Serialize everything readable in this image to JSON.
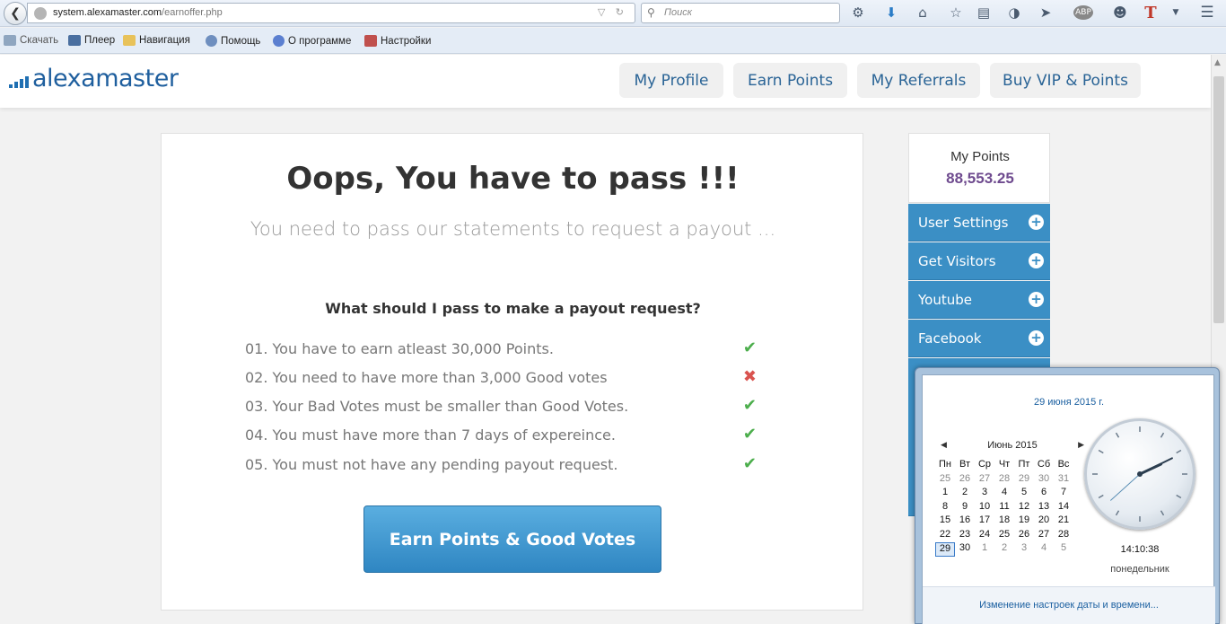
{
  "browser": {
    "url_host": "system.alexamaster.com",
    "url_path": "/earnoffer.php",
    "search_placeholder": "Поиск",
    "bookmarks": [
      {
        "label": "Скачать",
        "icon": "download-bookmark-icon"
      },
      {
        "label": "Плеер",
        "icon": "player-icon"
      },
      {
        "label": "Навигация",
        "icon": "folder-icon"
      },
      {
        "label": "Помощь",
        "icon": "help-icon"
      },
      {
        "label": "О программе",
        "icon": "info-icon"
      },
      {
        "label": "Настройки",
        "icon": "tools-icon"
      }
    ],
    "toolbar_icons": [
      "extension-icon",
      "download-arrow-icon",
      "home-icon",
      "star-icon",
      "reading-list-icon",
      "pocket-icon",
      "send-icon",
      "adblock-icon",
      "chat-icon",
      "translate-icon",
      "menu-icon"
    ],
    "adblock_label": "ABP",
    "translate_label": "T"
  },
  "site": {
    "logo": "alexamaster",
    "nav": [
      {
        "label": "My Profile"
      },
      {
        "label": "Earn Points"
      },
      {
        "label": "My Referrals"
      },
      {
        "label": "Buy VIP & Points"
      }
    ],
    "brand_color": "#1f5f9e"
  },
  "main": {
    "title": "Oops, You have to pass !!!",
    "subtitle": "You need to pass our statements to request a payout ...",
    "question": "What should I pass to make a payout request?",
    "requirements": [
      {
        "text": "01. You have to earn atleast 30,000 Points.",
        "status": "pass",
        "mark": "✔"
      },
      {
        "text": "02. You need to have more than 3,000 Good votes",
        "status": "fail",
        "mark": "✖"
      },
      {
        "text": "03. Your Bad Votes must be smaller than Good Votes.",
        "status": "pass",
        "mark": "✔"
      },
      {
        "text": "04. You must have more than 7 days of expereince.",
        "status": "pass",
        "mark": "✔"
      },
      {
        "text": "05. You must not have any pending payout request.",
        "status": "pass",
        "mark": "✔"
      }
    ],
    "cta_label": "Earn Points & Good Votes"
  },
  "sidebar": {
    "points_label": "My Points",
    "points_value": "88,553.25",
    "items": [
      {
        "label": "User Settings"
      },
      {
        "label": "Get Visitors"
      },
      {
        "label": "Youtube"
      },
      {
        "label": "Facebook"
      }
    ]
  },
  "calendar": {
    "full_date": "29 июня 2015 г.",
    "month_label": "Июнь 2015",
    "weekdays": [
      "Пн",
      "Вт",
      "Ср",
      "Чт",
      "Пт",
      "Сб",
      "Вс"
    ],
    "weeks": [
      [
        "25",
        "26",
        "27",
        "28",
        "29",
        "30",
        "31"
      ],
      [
        "1",
        "2",
        "3",
        "4",
        "5",
        "6",
        "7"
      ],
      [
        "8",
        "9",
        "10",
        "11",
        "12",
        "13",
        "14"
      ],
      [
        "15",
        "16",
        "17",
        "18",
        "19",
        "20",
        "21"
      ],
      [
        "22",
        "23",
        "24",
        "25",
        "26",
        "27",
        "28"
      ],
      [
        "29",
        "30",
        "1",
        "2",
        "3",
        "4",
        "5"
      ]
    ],
    "today": "29",
    "time": "14:10:38",
    "weekday": "понедельник",
    "settings_link": "Изменение настроек даты и времени..."
  }
}
